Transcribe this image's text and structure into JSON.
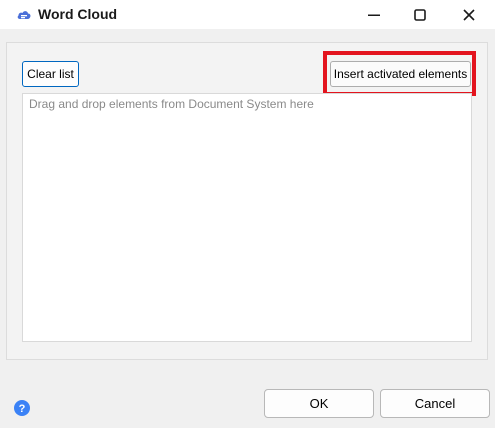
{
  "window": {
    "title": "Word Cloud",
    "app_icon": "word-cloud-icon",
    "controls": [
      "minimize-icon",
      "maximize-icon",
      "close-icon"
    ]
  },
  "toolbar": {
    "clear_label": "Clear list",
    "insert_label": "Insert activated elements"
  },
  "droplist": {
    "placeholder": "Drag and drop elements from Document System here"
  },
  "footer": {
    "help_icon": "help-icon",
    "ok_label": "OK",
    "cancel_label": "Cancel"
  },
  "colors": {
    "accent": "#0067c0",
    "highlight": "#e3141e",
    "help": "#3b82f6"
  }
}
